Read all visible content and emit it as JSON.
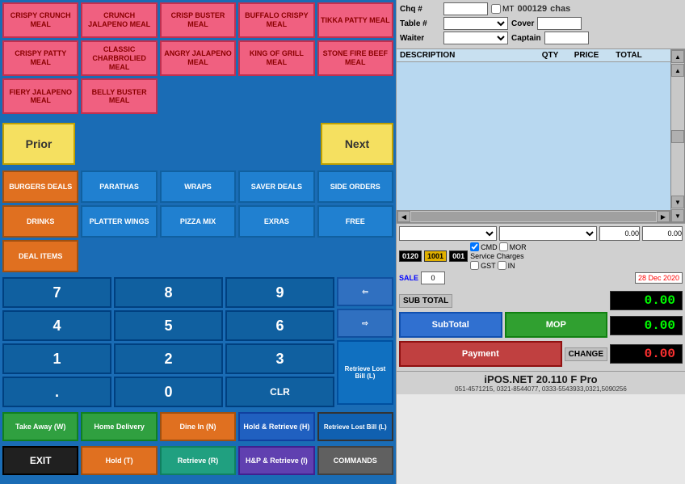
{
  "header": {
    "chq_label": "Chq #",
    "table_label": "Table #",
    "waiter_label": "Waiter",
    "mt_label": "MT",
    "order_num": "000129",
    "cover_label": "Cover",
    "captain_label": "Captain",
    "chas_value": "chas"
  },
  "menu": {
    "items": [
      {
        "label": "CRISPY CRUNCH MEAL"
      },
      {
        "label": "CRUNCH JALAPENO MEAL"
      },
      {
        "label": "CRISP BUSTER MEAL"
      },
      {
        "label": "BUFFALO CRISPY MEAL"
      },
      {
        "label": "TIKKA PATTY MEAL"
      },
      {
        "label": "CRISPY PATTY MEAL"
      },
      {
        "label": "CLASSIC CHARBROLIED MEAL"
      },
      {
        "label": "ANGRY JALAPENO MEAL"
      },
      {
        "label": "KING OF GRILL MEAL"
      },
      {
        "label": "STONE FIRE BEEF MEAL"
      },
      {
        "label": "FIERY JALAPENO MEAL"
      },
      {
        "label": "BELLY BUSTER MEAL"
      },
      {
        "label": ""
      },
      {
        "label": ""
      },
      {
        "label": ""
      }
    ]
  },
  "navigation": {
    "prior_label": "Prior",
    "next_label": "Next"
  },
  "categories": [
    {
      "label": "BURGERS DEALS"
    },
    {
      "label": "PARATHAS"
    },
    {
      "label": "WRAPS"
    },
    {
      "label": "SAVER DEALS"
    },
    {
      "label": "SIDE ORDERS"
    },
    {
      "label": "DRINKS"
    },
    {
      "label": "PLATTER WINGS"
    },
    {
      "label": "PIZZA MIX"
    },
    {
      "label": "EXRAS"
    },
    {
      "label": "FREE"
    },
    {
      "label": "DEAL ITEMS"
    },
    {
      "label": ""
    },
    {
      "label": ""
    },
    {
      "label": ""
    },
    {
      "label": ""
    }
  ],
  "numpad": {
    "buttons": [
      "7",
      "8",
      "9",
      "4",
      "5",
      "6",
      "1",
      "2",
      "3",
      ".",
      "0",
      "CLR"
    ]
  },
  "table_headers": {
    "description": "DESCRIPTION",
    "qty": "QTY",
    "price": "PRICE",
    "total": "TOTAL"
  },
  "bottom_actions": [
    {
      "label": "Take Away (W)",
      "color": "green"
    },
    {
      "label": "Home Delivery",
      "color": "green"
    },
    {
      "label": "Dine In (N)",
      "color": "orange"
    },
    {
      "label": "Hold & Retrieve (H)",
      "color": "blue"
    },
    {
      "label": "Retrieve Lost Bill (L)",
      "color": "blue"
    },
    {
      "label": "EXIT",
      "color": "dark"
    },
    {
      "label": "Hold (T)",
      "color": "orange"
    },
    {
      "label": "Retrieve (R)",
      "color": "teal"
    },
    {
      "label": "H&P & Retrieve (I)",
      "color": "purple"
    },
    {
      "label": "COMMANDS",
      "color": "gray"
    }
  ],
  "controls": {
    "code_0120": "0120",
    "code_1001": "1001",
    "code_001": "001",
    "cmd_label": "CMD",
    "mor_label": "MOR",
    "service_charges": "Service Charges",
    "gst_label": "GST",
    "in_label": "IN",
    "sale_label": "SALE",
    "sale_val": "0",
    "date": "28 Dec 2020"
  },
  "totals": {
    "sub_total_label": "SUB TOTAL",
    "sub_total_val": "0.00",
    "payment_label": "PAYMENT",
    "payment_val": "0.00",
    "change_label": "CHANGE",
    "change_val": "0.00"
  },
  "payment_buttons": {
    "subtotal": "SubTotal",
    "payment": "Payment",
    "mop": "MOP"
  },
  "footer": {
    "title": "iPOS.NET  20.110 F Pro",
    "contact": "051-4571215, 0321-8544077, 0333-5543933,0321,5090256"
  }
}
